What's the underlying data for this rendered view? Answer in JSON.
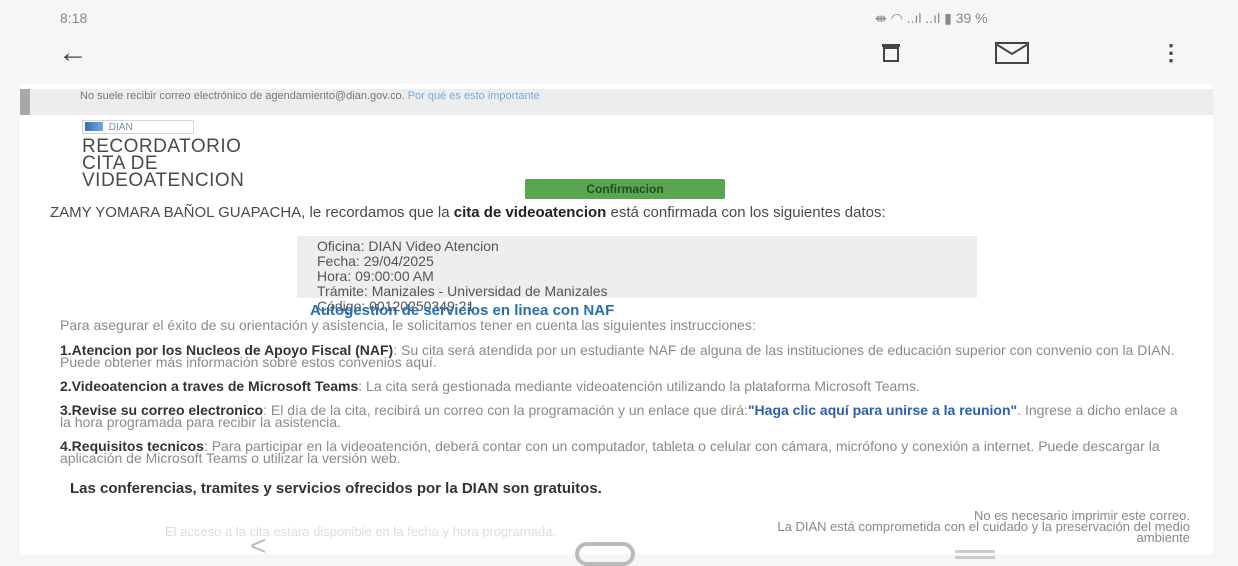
{
  "status_bar": {
    "time": "8:18",
    "right": "39 %"
  },
  "warning": {
    "text": "No suele recibir correo electrónico de agendamiento@dian.gov.co.",
    "link": "Por qué es esto importante"
  },
  "logo_text": "DIAN",
  "title": [
    "RECORDATORIO",
    "CITA DE",
    "VIDEOATENCION"
  ],
  "confirm_button": "Confirmacion",
  "intro": {
    "prefix": "ZAMY YOMARA BAÑOL GUAPACHA, le recordamos que la",
    "bold": "cita de videoatencion",
    "suffix": "está confirmada con los siguientes datos:"
  },
  "details": [
    "Oficina: DIAN Video Atencion",
    "Fecha: 29/04/2025",
    "Hora: 09:00:00 AM",
    "Trámite: Manizales - Universidad de Manizales",
    "Código: 00120250349 21"
  ],
  "section_title": "Autogestion de servicios en linea con NAF",
  "para0": "Para asegurar el éxito de su orientación y asistencia, le solicitamos tener en cuenta las siguientes instrucciones:",
  "item1": {
    "bold": "1.Atencion por los Nucleos de Apoyo Fiscal (NAF)",
    "text": ": Su cita será atendida por un estudiante NAF de alguna de las instituciones de educación superior con convenio con la DIAN. Puede obtener más información sobre estos convenios aquí."
  },
  "item2": {
    "bold": "2.Videoatencion a traves de Microsoft Teams",
    "text": ": La cita será gestionada mediante videoatención utilizando la plataforma Microsoft Teams."
  },
  "item3": {
    "bold": "3.Revise su correo electronico",
    "text": ": El día de la cita, recibirá un correo con la programación y un enlace que dirá:",
    "link": "\"Haga clic aquí para unirse a la reunion\"",
    "text2": ". Ingrese a dicho enlace a la hora programada para recibir la asistencia."
  },
  "item4": {
    "bold": "4.Requisitos tecnicos",
    "text": ": Para participar en la videoatención, deberá contar con un computador, tableta o celular con cámara, micrófono y conexión a internet. Puede descargar la aplicación de Microsoft Teams o utilizar la versión web."
  },
  "free": "Las conferencias, tramites y servicios ofrecidos por la DIAN son gratuitos.",
  "footer": [
    "No es necesario imprimir este correo.",
    "La DIAN está comprometida con el cuidado y la preservación del medio",
    "ambiente"
  ],
  "bottom_note": "El acceso a la cita estara disponible en la fecha y hora programada."
}
